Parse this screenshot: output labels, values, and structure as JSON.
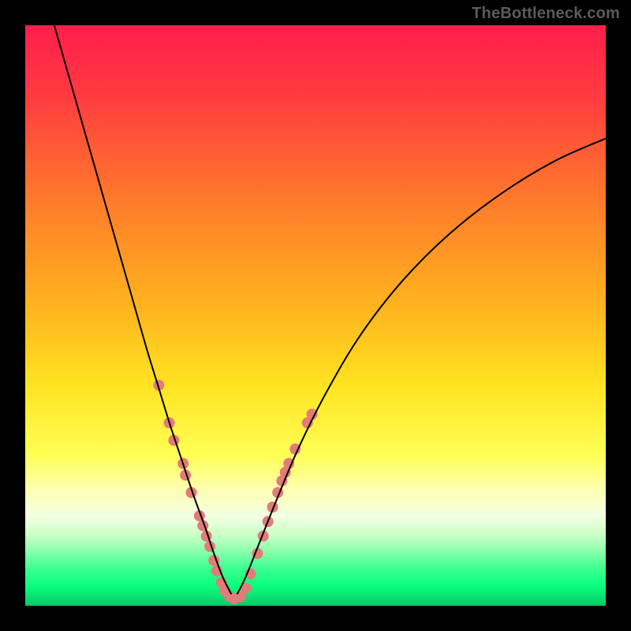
{
  "watermark": "TheBottleneck.com",
  "chart_data": {
    "type": "line",
    "title": "",
    "xlabel": "",
    "ylabel": "",
    "xlim": [
      0,
      100
    ],
    "ylim": [
      0,
      100
    ],
    "gradient_stops": [
      {
        "offset": 0.0,
        "color": "#ff1f4b"
      },
      {
        "offset": 0.12,
        "color": "#ff3a40"
      },
      {
        "offset": 0.3,
        "color": "#ff7a2b"
      },
      {
        "offset": 0.48,
        "color": "#ffb21f"
      },
      {
        "offset": 0.62,
        "color": "#ffe321"
      },
      {
        "offset": 0.74,
        "color": "#ffff55"
      },
      {
        "offset": 0.8,
        "color": "#fdffb0"
      },
      {
        "offset": 0.845,
        "color": "#f3ffe3"
      },
      {
        "offset": 0.875,
        "color": "#cfffc8"
      },
      {
        "offset": 0.905,
        "color": "#8dffad"
      },
      {
        "offset": 0.935,
        "color": "#3dff90"
      },
      {
        "offset": 0.965,
        "color": "#0bff7e"
      },
      {
        "offset": 1.0,
        "color": "#09c868"
      }
    ],
    "series": [
      {
        "name": "left-curve",
        "x": [
          5,
          7,
          9,
          11,
          13,
          15,
          17,
          19,
          21,
          23,
          25,
          27,
          29,
          31,
          32.5,
          34,
          35.5
        ],
        "y": [
          100,
          93,
          86,
          79,
          72,
          65,
          58,
          51,
          44,
          37.5,
          31,
          25,
          19,
          13.5,
          9,
          5,
          2
        ]
      },
      {
        "name": "right-curve",
        "x": [
          36.5,
          38,
          40,
          43,
          47,
          52,
          58,
          65,
          73,
          82,
          91,
          100
        ],
        "y": [
          2,
          5,
          10,
          17.5,
          27,
          37,
          47,
          56,
          64,
          71,
          76.5,
          80.5
        ]
      }
    ],
    "scatter_points": {
      "name": "marker-cluster",
      "color": "#e27c78",
      "radius": 7,
      "points": [
        {
          "x": 23.0,
          "y": 38.0
        },
        {
          "x": 24.8,
          "y": 31.5
        },
        {
          "x": 25.6,
          "y": 28.5
        },
        {
          "x": 27.2,
          "y": 24.5
        },
        {
          "x": 27.6,
          "y": 22.5
        },
        {
          "x": 28.6,
          "y": 19.5
        },
        {
          "x": 30.0,
          "y": 15.5
        },
        {
          "x": 30.6,
          "y": 13.8
        },
        {
          "x": 31.2,
          "y": 12.0
        },
        {
          "x": 31.8,
          "y": 10.2
        },
        {
          "x": 32.5,
          "y": 7.8
        },
        {
          "x": 33.0,
          "y": 6.0
        },
        {
          "x": 33.8,
          "y": 4.0
        },
        {
          "x": 34.4,
          "y": 2.6
        },
        {
          "x": 35.2,
          "y": 1.6
        },
        {
          "x": 36.0,
          "y": 1.2
        },
        {
          "x": 37.0,
          "y": 1.5
        },
        {
          "x": 38.0,
          "y": 3.0
        },
        {
          "x": 38.8,
          "y": 5.5
        },
        {
          "x": 40.0,
          "y": 9.0
        },
        {
          "x": 41.0,
          "y": 12.0
        },
        {
          "x": 41.8,
          "y": 14.5
        },
        {
          "x": 42.6,
          "y": 17.0
        },
        {
          "x": 43.5,
          "y": 19.5
        },
        {
          "x": 44.2,
          "y": 21.5
        },
        {
          "x": 44.8,
          "y": 23.0
        },
        {
          "x": 45.4,
          "y": 24.5
        },
        {
          "x": 46.5,
          "y": 27.0
        },
        {
          "x": 48.6,
          "y": 31.5
        },
        {
          "x": 49.4,
          "y": 33.0
        }
      ]
    }
  }
}
